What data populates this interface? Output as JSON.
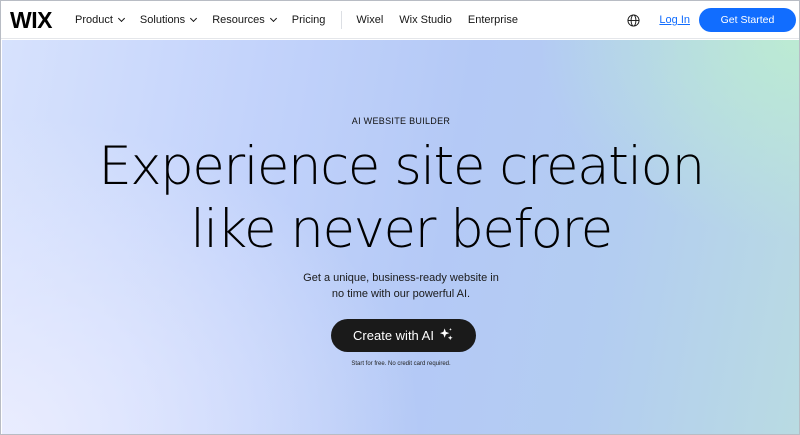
{
  "brand": {
    "logo_text": "WIX"
  },
  "nav": {
    "items": [
      {
        "label": "Product",
        "dropdown": true
      },
      {
        "label": "Solutions",
        "dropdown": true
      },
      {
        "label": "Resources",
        "dropdown": true
      },
      {
        "label": "Pricing",
        "dropdown": false
      }
    ],
    "secondary_items": [
      {
        "label": "Wixel"
      },
      {
        "label": "Wix Studio"
      },
      {
        "label": "Enterprise"
      }
    ],
    "language_icon": "globe-icon",
    "login_label": "Log In",
    "cta_label": "Get Started"
  },
  "hero": {
    "eyebrow": "AI WEBSITE BUILDER",
    "headline_line1": "Experience site creation",
    "headline_line2": "like never before",
    "sub_line1": "Get a unique, business-ready website in",
    "sub_line2": "no time with our powerful AI.",
    "button_label": "Create with AI",
    "button_icon": "sparkle-icon",
    "note": "Start for free. No credit card required."
  },
  "colors": {
    "accent": "#116dff",
    "button_dark": "#1a1a1a",
    "link": "#116dff"
  }
}
